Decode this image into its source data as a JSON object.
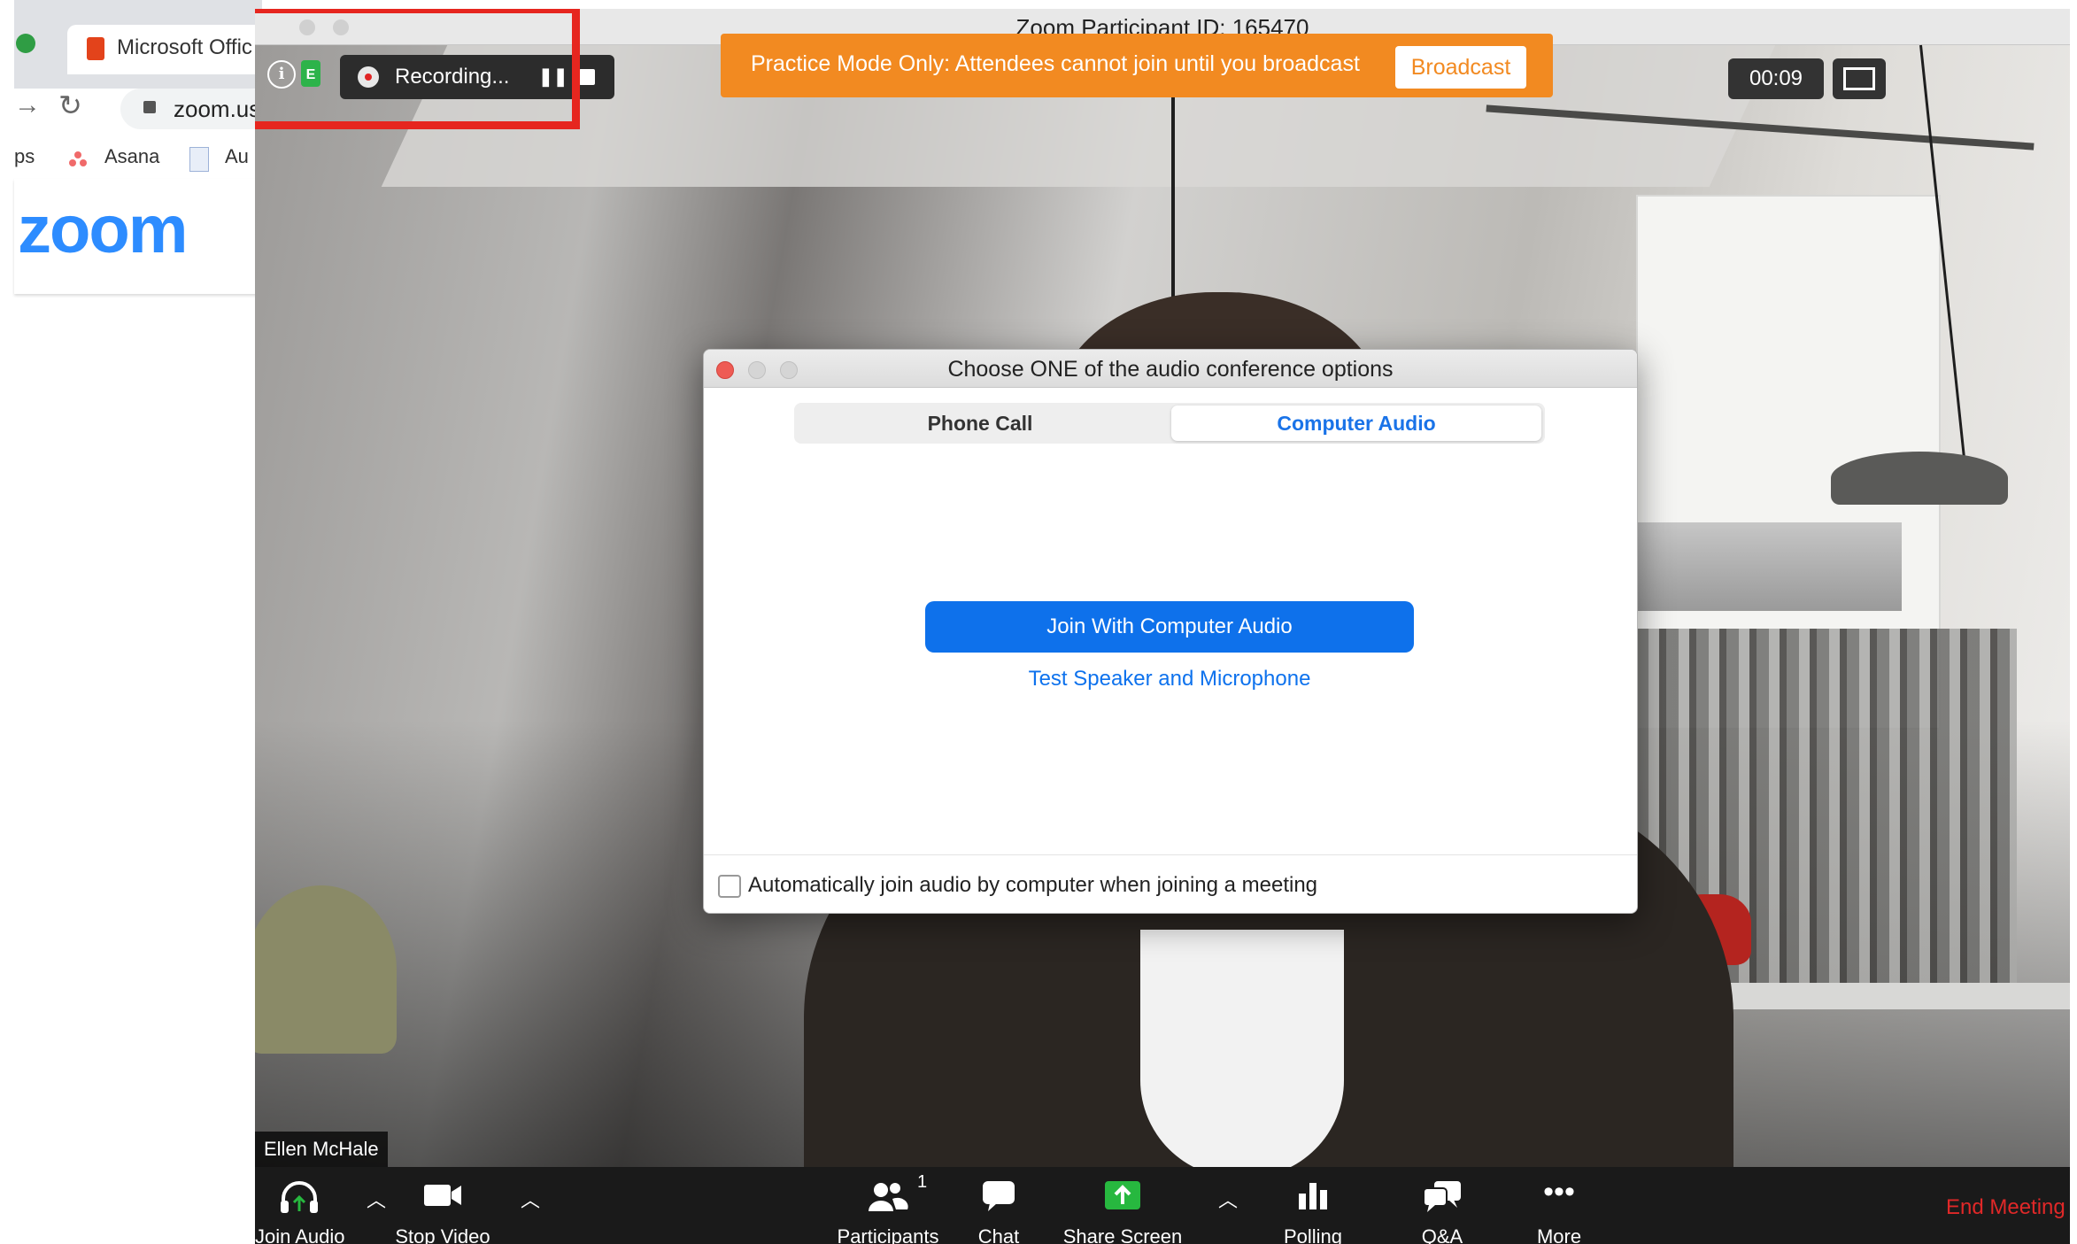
{
  "browser": {
    "tab_title": "Microsoft Offic",
    "url": "zoom.us",
    "bookmarks": [
      {
        "label": "ps"
      },
      {
        "label": "Asana"
      },
      {
        "label": "Au"
      }
    ],
    "logo_text": "zoom"
  },
  "window": {
    "title": "Zoom Participant ID: 165470"
  },
  "recording": {
    "label": "Recording...",
    "encryption_badge": "E"
  },
  "practice_banner": {
    "text": "Practice Mode Only: Attendees cannot join until you broadcast",
    "button_label": "Broadcast"
  },
  "timer": "00:09",
  "dialog": {
    "title": "Choose ONE of the audio conference options",
    "tabs": [
      {
        "label": "Phone Call",
        "selected": false
      },
      {
        "label": "Computer Audio",
        "selected": true
      }
    ],
    "join_button": "Join With Computer Audio",
    "test_link": "Test Speaker and Microphone",
    "auto_join_label": "Automatically join audio by computer when joining a meeting",
    "auto_join_checked": false
  },
  "participant_name": "Ellen McHale",
  "toolbar": {
    "join_audio": "Join Audio",
    "stop_video": "Stop Video",
    "participants": "Participants",
    "participants_count": "1",
    "chat": "Chat",
    "share_screen": "Share Screen",
    "polling": "Polling",
    "qa": "Q&A",
    "more": "More",
    "end_meeting": "End Meeting"
  },
  "colors": {
    "accent_blue": "#0e71eb",
    "practice_orange": "#f28a21",
    "highlight_red": "#e6261f",
    "end_red": "#e02828",
    "share_green": "#27b83f"
  }
}
